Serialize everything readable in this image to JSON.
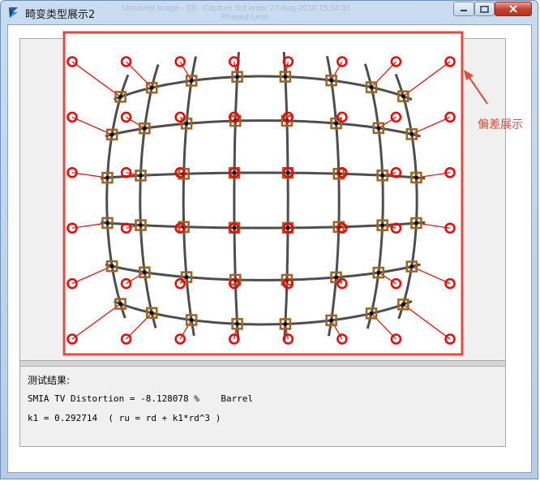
{
  "window": {
    "title": "畸变类型展示2",
    "ghost_title": "Unsaved Image - (0) - Capture 3rd order  27-Aug-2010 15:34:31",
    "ghost_subtitle": "Phased Lens"
  },
  "results": {
    "heading": "测试结果:",
    "distortion_line": "SMIA TV Distortion = -8.128078 %    Barrel",
    "k1_line": "k1 = 0.292714  ( ru = rd + k1*rd^3 )"
  },
  "annotation": {
    "label": "偏差展示"
  },
  "colors": {
    "highlight_red": "#e8483c",
    "ideal_marker": "#ff0000",
    "measured_marker": "#a0641e",
    "grid_line": "#2f2f2f"
  },
  "grid": {
    "columns": 8,
    "rows": 6,
    "distortion_type": "Barrel",
    "distortion_percent": -8.128078,
    "k1": 0.292714
  }
}
